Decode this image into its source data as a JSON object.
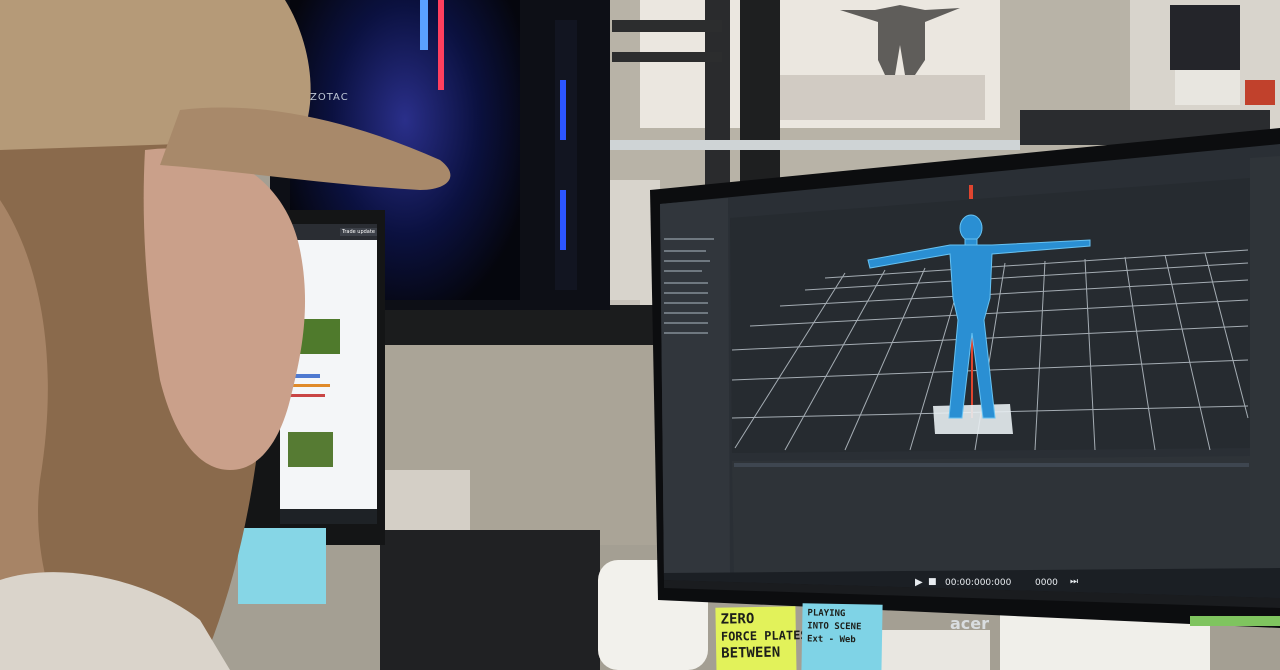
{
  "scene": {
    "description_free": true,
    "computer_brand": "ZOTAC",
    "monitor_brand": "acer",
    "timecode": "00:00:000:000",
    "frame_counter": "0000",
    "sticky_note_left": [
      "ZERO",
      "FORCE PLATES",
      "BETWEEN"
    ],
    "sticky_note_right": [
      "PLAYING",
      "INTO SCENE",
      "Ext - Web"
    ],
    "left_monitor_button": "Trade update"
  },
  "colors": {
    "wall": "#a49f93",
    "viewport_bg": "#262b30",
    "grid_line": "#d9e3ea",
    "avatar": "#2a8fd3",
    "sticky_yellow": "#e2f25a",
    "sticky_blue": "#7fd3e6",
    "hat": "#b59a78"
  },
  "icons": [
    "gear-icon",
    "play-icon",
    "stop-icon",
    "skip-icon"
  ]
}
